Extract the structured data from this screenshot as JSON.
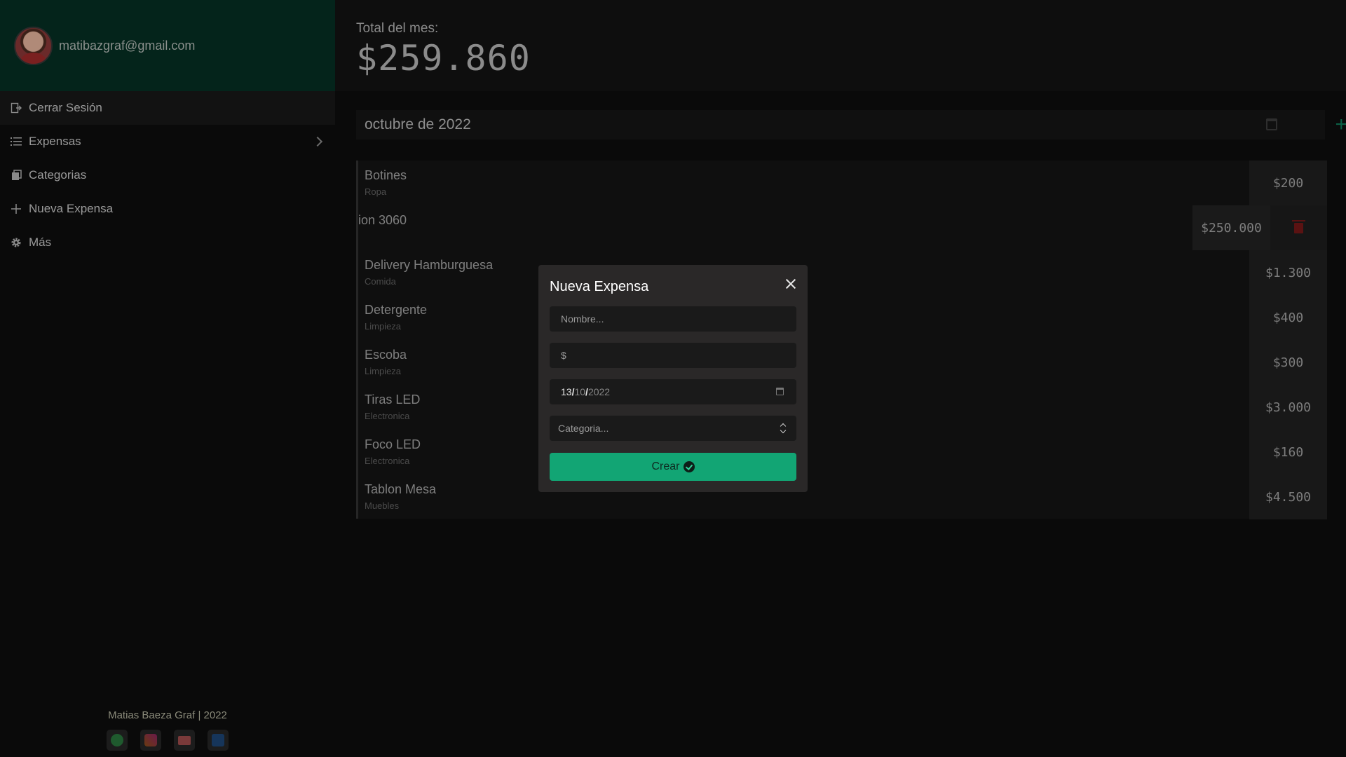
{
  "sidebar": {
    "email": "matibazgraf@gmail.com",
    "items": [
      {
        "label": "Cerrar Sesión",
        "icon": "logout-icon"
      },
      {
        "label": "Expensas",
        "icon": "list-icon"
      },
      {
        "label": "Categorias",
        "icon": "categories-icon"
      },
      {
        "label": "Nueva Expensa",
        "icon": "plus-icon"
      },
      {
        "label": "Más",
        "icon": "gear-icon"
      }
    ],
    "footer": "Matias Baeza Graf | 2022",
    "socials": [
      "whatsapp-icon",
      "instagram-icon",
      "gmail-icon",
      "linkedin-icon"
    ]
  },
  "header": {
    "total_label": "Total del mes:",
    "total_value": "$259.860"
  },
  "month": {
    "label": "octubre de 2022"
  },
  "expenses": [
    {
      "name": "Botines",
      "category": "Ropa",
      "amount": "$200"
    },
    {
      "name": "ion 3060",
      "category": "",
      "amount": "$250.000"
    },
    {
      "name": "Delivery Hamburguesa",
      "category": "Comida",
      "amount": "$1.300"
    },
    {
      "name": "Detergente",
      "category": "Limpieza",
      "amount": "$400"
    },
    {
      "name": "Escoba",
      "category": "Limpieza",
      "amount": "$300"
    },
    {
      "name": "Tiras LED",
      "category": "Electronica",
      "amount": "$3.000"
    },
    {
      "name": "Foco LED",
      "category": "Electronica",
      "amount": "$160"
    },
    {
      "name": "Tablon Mesa",
      "category": "Muebles",
      "amount": "$4.500"
    }
  ],
  "modal": {
    "title": "Nueva Expensa",
    "name_placeholder": "Nombre...",
    "amount_prefix": "$",
    "date_day": "13",
    "date_month": "10",
    "date_year": "2022",
    "category_placeholder": "Categoria...",
    "submit_label": "Crear"
  },
  "colors": {
    "accent": "#12a574",
    "profile_bg": "#04241b",
    "delete": "#5a1212"
  }
}
